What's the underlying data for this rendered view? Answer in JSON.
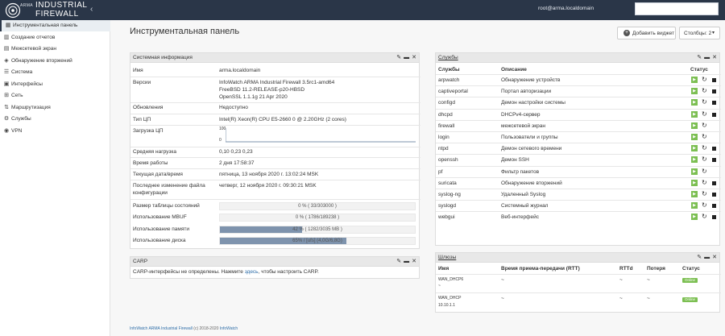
{
  "header": {
    "brand_small": "ARMA",
    "brand_line1": "INDUSTRIAL",
    "brand_line2": "FIREWALL",
    "user": "root@arma.localdomain",
    "search_placeholder": ""
  },
  "sidebar": {
    "items": [
      {
        "label": "Инструментальная панель",
        "icon": "dashboard-icon"
      },
      {
        "label": "Создание отчетов",
        "icon": "report-icon"
      },
      {
        "label": "Межсетевой экран",
        "icon": "firewall-icon"
      },
      {
        "label": "Обнаружение вторжений",
        "icon": "shield-icon"
      },
      {
        "label": "Система",
        "icon": "system-icon"
      },
      {
        "label": "Интерфейсы",
        "icon": "interfaces-icon"
      },
      {
        "label": "Сеть",
        "icon": "network-icon"
      },
      {
        "label": "Маршрутизация",
        "icon": "routing-icon"
      },
      {
        "label": "Службы",
        "icon": "services-icon"
      },
      {
        "label": "VPN",
        "icon": "vpn-icon"
      }
    ]
  },
  "page": {
    "title": "Инструментальная панель",
    "add_widget": "Добавить виджет",
    "columns": "Столбцы: 2"
  },
  "sysinfo": {
    "title": "Системная информация",
    "name_label": "Имя",
    "name": "arma.localdomain",
    "versions_label": "Версии",
    "versions": [
      "InfoWatch ARMA Industrial Firewall 3.5rc1-amd64",
      "FreeBSD 11.2-RELEASE-p20-HBSD",
      "OpenSSL 1.1.1g 21 Apr 2020"
    ],
    "updates_label": "Обновления",
    "updates": "Недоступно",
    "cpu_type_label": "Тип ЦП",
    "cpu_type": "Intel(R) Xeon(R) CPU E5-2660 0 @ 2.20GHz (2 cores)",
    "cpu_load_label": "Загрузка ЦП",
    "cpu_max": "100",
    "cpu_min": "0",
    "load_avg_label": "Средняя нагрузка",
    "load_avg": "0,10 0,23 0,23",
    "uptime_label": "Время работы",
    "uptime": "2 дня 17:58:37",
    "datetime_label": "Текущая дата/время",
    "datetime": "пятница, 13 ноября 2020 г. 13:02:24 MSK",
    "config_label_1": "Последнее изменение файла",
    "config_label_2": "конфигурации",
    "config": "четверг, 12 ноября 2020 г. 09:30:21 MSK",
    "state_table_label": "Размер таблицы состояний",
    "state_table": "0 % ( 33/303000 )",
    "state_table_pct": 0,
    "mbuf_label": "Использование MBUF",
    "mbuf": "0 % ( 1786/189238 )",
    "mbuf_pct": 0,
    "memory_label": "Использование памяти",
    "memory": "42 % ( 1282/3035 MB )",
    "memory_pct": 42,
    "disk_label": "Использование диска",
    "disk": "65% / [ufs] (4,0G/6,8G)",
    "disk_pct": 65
  },
  "carp": {
    "title": "CARP",
    "text_before": "CARP-интерфейсы не определены. Нажмите ",
    "link": "здесь",
    "text_after": ", чтобы настроить CARP."
  },
  "services": {
    "title": "Службы",
    "col_service": "Службы",
    "col_desc": "Описание",
    "col_status": "Статус",
    "rows": [
      {
        "name": "arpwatch",
        "desc": "Обнаружение устройств",
        "stop": true
      },
      {
        "name": "captiveportal",
        "desc": "Портал авторизации",
        "stop": true
      },
      {
        "name": "configd",
        "desc": "Демон настройки системы",
        "stop": true
      },
      {
        "name": "dhcpd",
        "desc": "DHCPv4-сервер",
        "stop": true
      },
      {
        "name": "firewall",
        "desc": "межсетевой экран",
        "stop": false
      },
      {
        "name": "login",
        "desc": "Пользователи и группы",
        "stop": false
      },
      {
        "name": "ntpd",
        "desc": "Демон сетевого времени",
        "stop": true
      },
      {
        "name": "openssh",
        "desc": "Демон SSH",
        "stop": true
      },
      {
        "name": "pf",
        "desc": "Фильтр пакетов",
        "stop": false
      },
      {
        "name": "suricata",
        "desc": "Обнаружение вторжений",
        "stop": true
      },
      {
        "name": "syslog-ng",
        "desc": "Удаленный Syslog",
        "stop": true
      },
      {
        "name": "syslogd",
        "desc": "Системный журнал",
        "stop": true
      },
      {
        "name": "webgui",
        "desc": "Веб-интерфейс",
        "stop": true
      }
    ]
  },
  "gateways": {
    "title": "Шлюзы",
    "col_name": "Имя",
    "col_rtt": "Время приема-передачи (RTT)",
    "col_rttd": "RTTd",
    "col_loss": "Потеря",
    "col_status": "Статус",
    "rows": [
      {
        "name": "WAN_DHCP6",
        "addr": "~",
        "rtt": "~",
        "rttd": "~",
        "loss": "~",
        "status": "Online"
      },
      {
        "name": "WAN_DHCP",
        "addr": "10.10.1.1",
        "rtt": "~",
        "rttd": "~",
        "loss": "~",
        "status": "Online"
      }
    ]
  },
  "footer": {
    "product": "InfoWatch ARMA Industrial Firewall",
    "copy": "(c) 2018-2020",
    "company": "InfoWatch"
  },
  "colors": {
    "topbar": "#2a3648",
    "online": "#7cbf52",
    "bar_fill": "#7e93ad"
  }
}
